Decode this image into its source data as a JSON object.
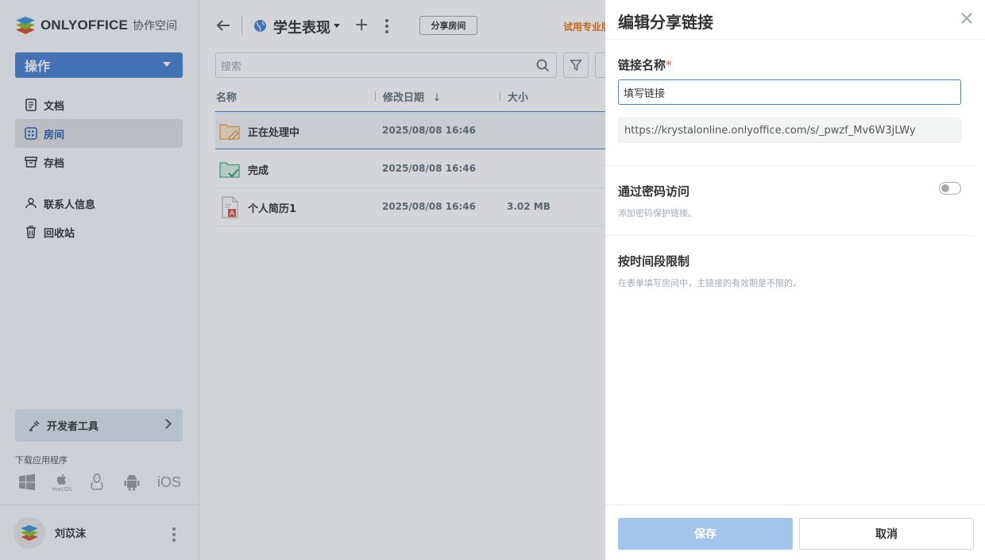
{
  "brand": {
    "name": "ONLYOFFICE",
    "subtitle": "协作空间"
  },
  "sidebar": {
    "action_label": "操作",
    "items": [
      {
        "label": "文档",
        "icon": "document-icon"
      },
      {
        "label": "房间",
        "icon": "rooms-icon",
        "active": true
      },
      {
        "label": "存档",
        "icon": "archive-icon"
      },
      {
        "label": "联系人信息",
        "icon": "contacts-icon"
      },
      {
        "label": "回收站",
        "icon": "trash-icon"
      }
    ],
    "dev_tools_label": "开发者工具",
    "download_label": "下载应用程序",
    "apps": [
      "windows-icon",
      "macos-icon",
      "linux-icon",
      "android-icon",
      "iOS"
    ],
    "macos_label": "macOS",
    "ios_label": "iOS",
    "user_name": "刘苡沫"
  },
  "header": {
    "room_title": "学生表现",
    "share_room_label": "分享房间",
    "trial_label": "试用专业版"
  },
  "search": {
    "placeholder": "搜索"
  },
  "table": {
    "columns": {
      "name": "名称",
      "modified": "修改日期",
      "size": "大小"
    },
    "rows": [
      {
        "name": "正在处理中",
        "modified": "2025/08/08 16:46",
        "size": "",
        "icon": "folder-in-progress-icon"
      },
      {
        "name": "完成",
        "modified": "2025/08/08 16:46",
        "size": "",
        "icon": "folder-done-icon"
      },
      {
        "name": "个人简历1",
        "modified": "2025/08/08 16:46",
        "size": "3.02 MB",
        "icon": "pdf-file-icon"
      }
    ]
  },
  "panel": {
    "title": "编辑分享链接",
    "link_name_label": "链接名称",
    "required_mark": "*",
    "link_name_value": "填写链接",
    "link_url": "https://krystalonline.onlyoffice.com/s/_pwzf_Mv6W3jLWy",
    "password_title": "通过密码访问",
    "password_desc": "添加密码保护链接。",
    "password_enabled": false,
    "time_title": "按时间段限制",
    "time_desc": "在表单填写房间中，主链接的有效期是不限的。",
    "save_label": "保存",
    "cancel_label": "取消"
  },
  "colors": {
    "accent": "#4781d1",
    "save_disabled": "#a3c5eb",
    "trial": "#ed7309",
    "required": "#e8573f"
  }
}
